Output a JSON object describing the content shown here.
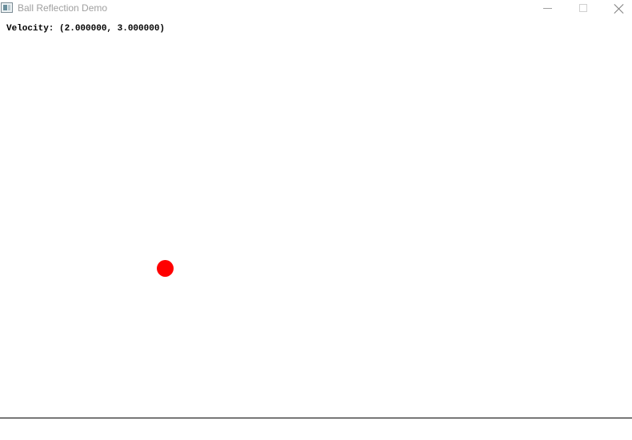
{
  "window": {
    "title": "Ball Reflection Demo",
    "app_icon": "window-app-icon"
  },
  "caption_buttons": {
    "minimize_icon": "minimize-icon",
    "maximize_icon": "maximize-icon",
    "close_icon": "close-icon"
  },
  "canvas": {
    "velocity_text": "Velocity: (2.000000, 3.000000)",
    "ball_color": "#ff0000",
    "background_color": "#ffffff"
  }
}
